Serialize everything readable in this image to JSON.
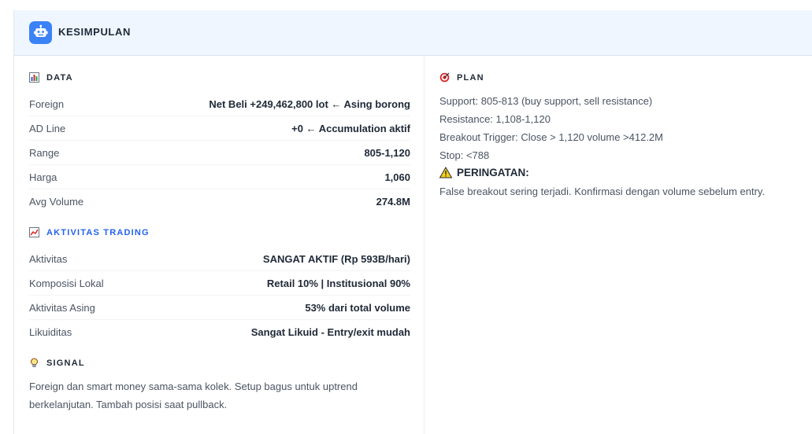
{
  "header": {
    "title": "KESIMPULAN",
    "icon": "robot-icon",
    "icon_bg": "#3b82f6"
  },
  "data_section": {
    "title": "DATA",
    "icon": "bar-chart-icon",
    "rows": [
      {
        "label": "Foreign",
        "value": "Net Beli +249,462,800 lot ← Asing borong"
      },
      {
        "label": "AD Line",
        "value": "+0 ← Accumulation aktif"
      },
      {
        "label": "Range",
        "value": "805-1,120"
      },
      {
        "label": "Harga",
        "value": "1,060"
      },
      {
        "label": "Avg Volume",
        "value": "274.8M"
      }
    ]
  },
  "trading_section": {
    "title": "AKTIVITAS TRADING",
    "icon": "trend-chart-icon",
    "title_color": "#2563eb",
    "rows": [
      {
        "label": "Aktivitas",
        "value": "SANGAT AKTIF (Rp 593B/hari)"
      },
      {
        "label": "Komposisi Lokal",
        "value": "Retail 10% | Institusional 90%"
      },
      {
        "label": "Aktivitas Asing",
        "value": "53% dari total volume"
      },
      {
        "label": "Likuiditas",
        "value": "Sangat Likuid - Entry/exit mudah"
      }
    ]
  },
  "signal_section": {
    "title": "SIGNAL",
    "icon": "lightbulb-icon",
    "text_line1": "Foreign dan smart money sama-sama kolek. Setup bagus untuk uptrend",
    "text_line2": "berkelanjutan. Tambah posisi saat pullback."
  },
  "plan_section": {
    "title": "PLAN",
    "icon": "target-icon",
    "lines": [
      "Support: 805-813 (buy support, sell resistance)",
      "Resistance: 1,108-1,120",
      "Breakout Trigger: Close > 1,120 volume >412.2M",
      "Stop: <788"
    ],
    "warning_title": "PERINGATAN:",
    "warning_icon": "warning-icon",
    "warning_text": "False breakout sering terjadi. Konfirmasi dengan volume sebelum entry."
  }
}
